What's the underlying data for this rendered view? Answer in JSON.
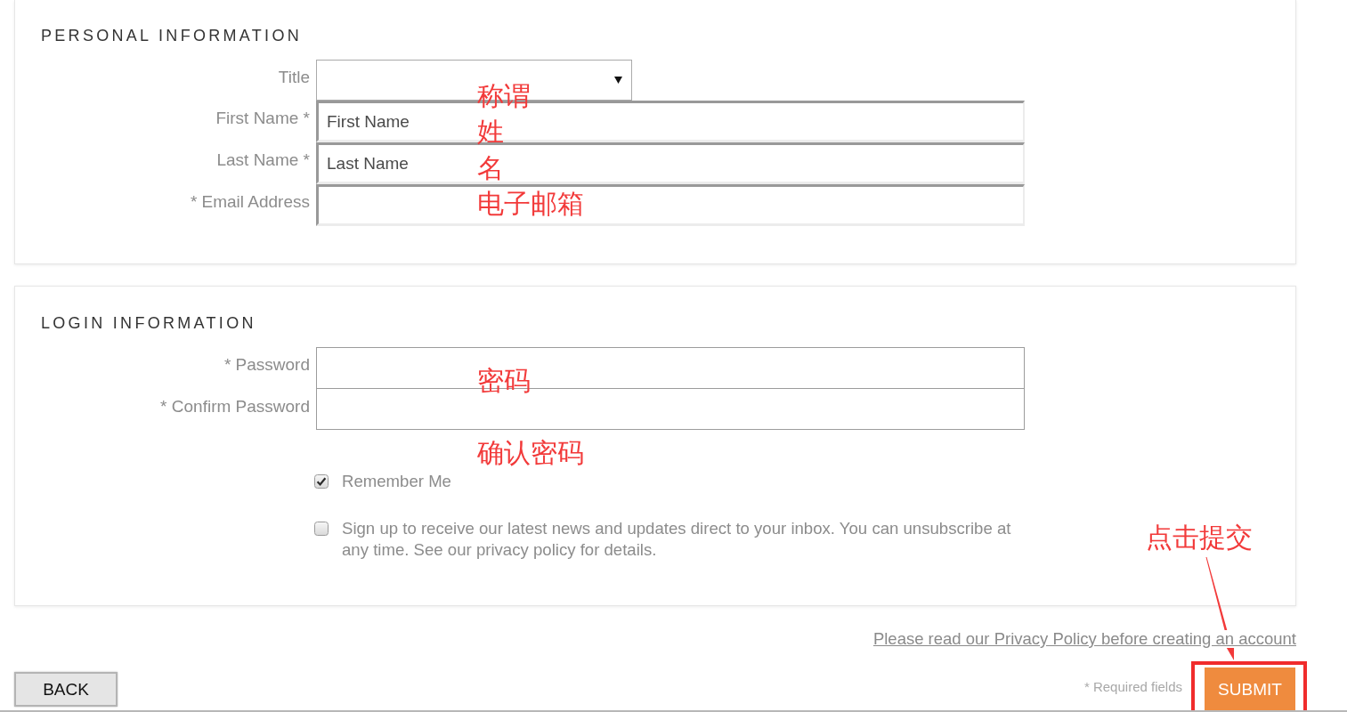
{
  "sections": [
    {
      "title": "PERSONAL INFORMATION",
      "fields": [
        {
          "kind": "select",
          "label": "Title"
        },
        {
          "kind": "text",
          "label": "First Name *",
          "placeholder": "First Name"
        },
        {
          "kind": "text",
          "label": "Last Name *",
          "placeholder": "Last Name"
        },
        {
          "kind": "text",
          "label": "* Email Address"
        }
      ],
      "annotations": [
        "称谓",
        "姓",
        "名",
        "电子邮箱"
      ]
    },
    {
      "title": "LOGIN INFORMATION",
      "fields": [
        {
          "kind": "password",
          "label": "* Password"
        },
        {
          "kind": "password",
          "label": "* Confirm Password"
        }
      ],
      "options": [
        {
          "label": "Remember Me",
          "checked": true
        },
        {
          "label": "Sign up to receive our latest news and updates direct to your inbox. You can unsubscribe at any time. See our privacy policy for details.",
          "checked": false
        }
      ],
      "annotations": [
        "密码",
        "确认密码"
      ]
    }
  ],
  "privacy_link": "Please read our Privacy Policy before creating an account",
  "back_button": "BACK",
  "required_note": "* Required fields",
  "submit_button": "SUBMIT",
  "submit_annotation": "点击提交"
}
